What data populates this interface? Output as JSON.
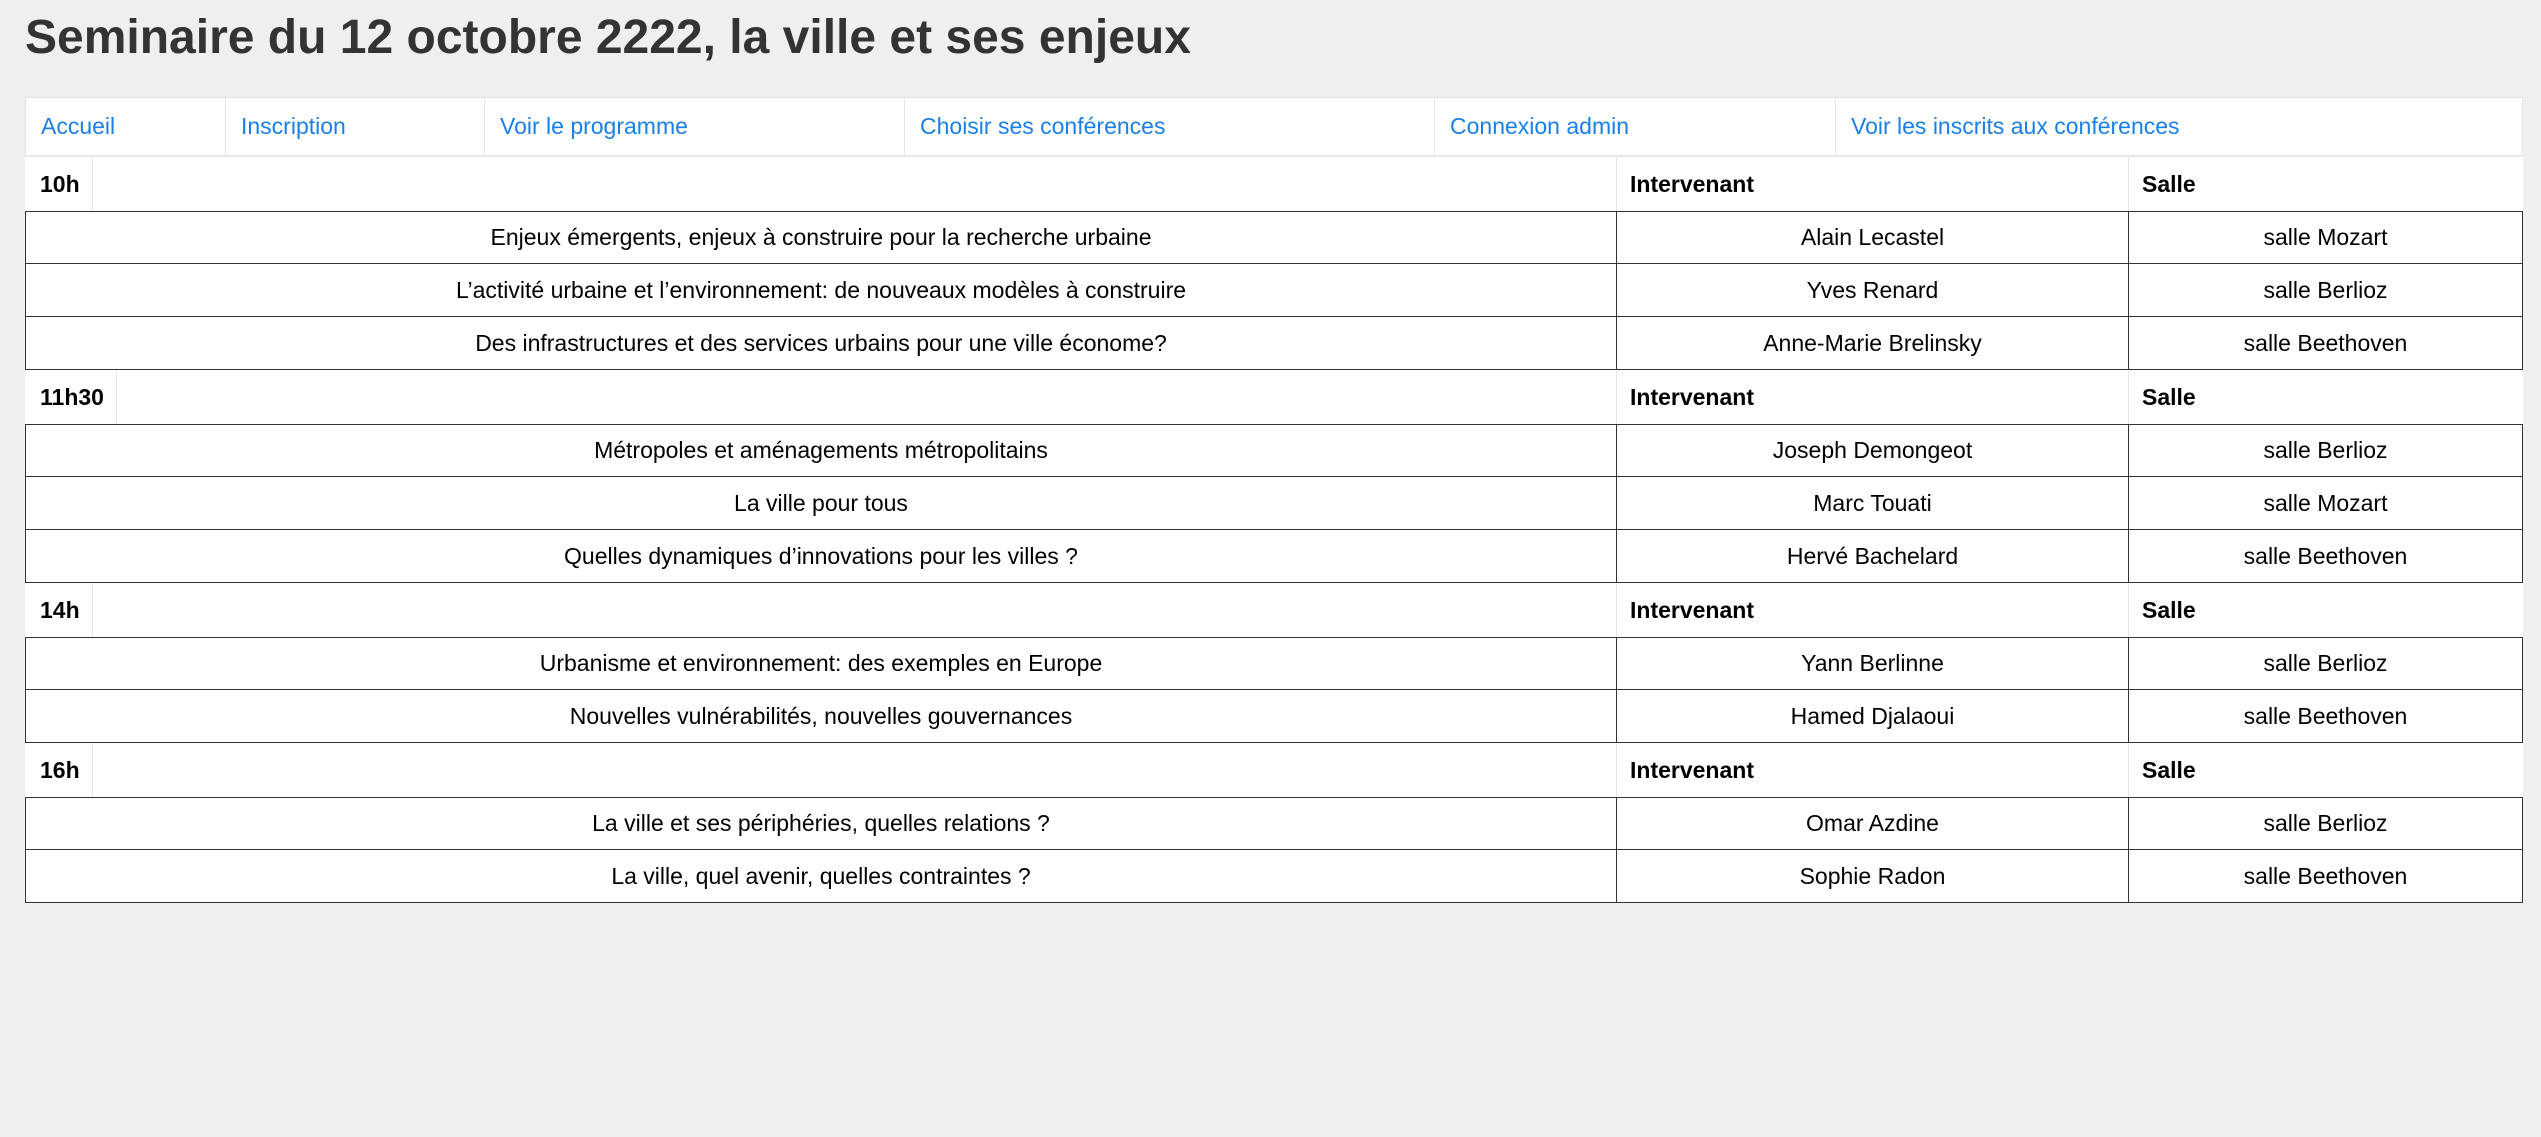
{
  "page": {
    "title": "Seminaire du 12 octobre 2222, la ville et ses enjeux"
  },
  "colors": {
    "background": "#efefef",
    "link": "#1a7fe6",
    "title": "#333333"
  },
  "nav": {
    "items": [
      {
        "label": "Accueil"
      },
      {
        "label": "Inscription"
      },
      {
        "label": "Voir le programme"
      },
      {
        "label": "Choisir ses conférences"
      },
      {
        "label": "Connexion admin"
      },
      {
        "label": "Voir les inscrits aux conférences"
      }
    ]
  },
  "schedule": {
    "speaker_header": "Intervenant",
    "room_header": "Salle",
    "sessions": [
      {
        "time": "10h",
        "talks": [
          {
            "title": "Enjeux émergents, enjeux à construire pour la recherche urbaine",
            "speaker": "Alain Lecastel",
            "room": "salle Mozart"
          },
          {
            "title": "L’activité urbaine et l’environnement: de nouveaux modèles à construire",
            "speaker": "Yves Renard",
            "room": "salle Berlioz"
          },
          {
            "title": "Des infrastructures et des services urbains pour une ville économe?",
            "speaker": "Anne-Marie Brelinsky",
            "room": "salle Beethoven"
          }
        ]
      },
      {
        "time": "11h30",
        "talks": [
          {
            "title": "Métropoles et aménagements métropolitains",
            "speaker": "Joseph Demongeot",
            "room": "salle Berlioz"
          },
          {
            "title": "La ville pour tous",
            "speaker": "Marc Touati",
            "room": "salle Mozart"
          },
          {
            "title": "Quelles dynamiques d’innovations pour les villes ?",
            "speaker": "Hervé Bachelard",
            "room": "salle Beethoven"
          }
        ]
      },
      {
        "time": "14h",
        "talks": [
          {
            "title": "Urbanisme et environnement: des exemples en Europe",
            "speaker": "Yann Berlinne",
            "room": "salle Berlioz"
          },
          {
            "title": "Nouvelles vulnérabilités, nouvelles gouvernances",
            "speaker": "Hamed Djalaoui",
            "room": "salle Beethoven"
          }
        ]
      },
      {
        "time": "16h",
        "talks": [
          {
            "title": "La ville et ses périphéries, quelles relations ?",
            "speaker": "Omar Azdine",
            "room": "salle Berlioz"
          },
          {
            "title": "La ville, quel avenir, quelles contraintes ?",
            "speaker": "Sophie Radon",
            "room": "salle Beethoven"
          }
        ]
      }
    ]
  }
}
